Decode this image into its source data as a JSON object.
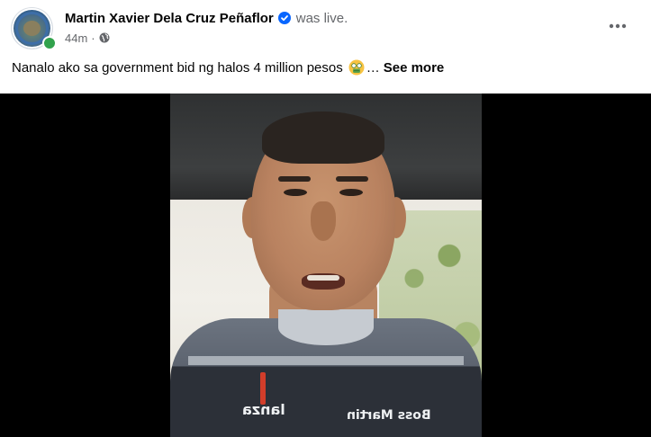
{
  "post": {
    "author_name": "Martin Xavier Dela Cruz Peñaflor",
    "status_text": "was live.",
    "timestamp": "44m",
    "separator": "·",
    "privacy_icon": "globe-icon",
    "verified_icon": "verified-badge-icon",
    "body_text": "Nanalo ako sa government bid ng halos 4 million pesos",
    "body_emoji": "money-mouth-face-emoji",
    "ellipsis": "…",
    "see_more_label": "See more",
    "more_options_icon": "more-horizontal-icon"
  },
  "video": {
    "shirt_text_left": "lanza",
    "shirt_text_right": "Boss Martin"
  },
  "colors": {
    "verified_blue": "#0866ff",
    "online_green": "#31a24c",
    "secondary_text": "#65676b",
    "primary_text": "#050505"
  }
}
